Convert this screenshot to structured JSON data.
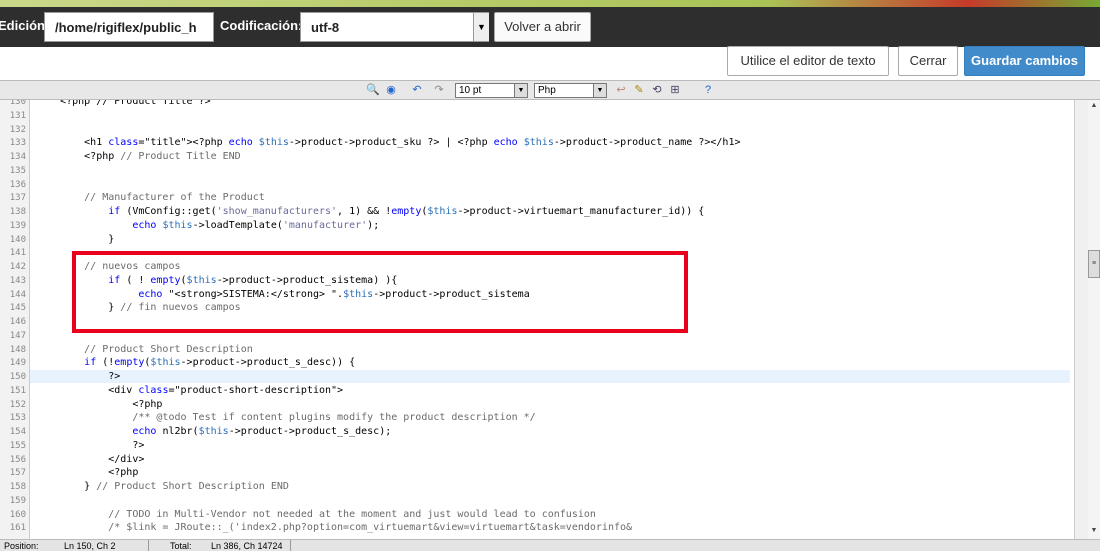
{
  "header": {
    "edit_label": "Edición:",
    "path_value": "/home/rigiflex/public_h",
    "encoding_label": "Codificación:",
    "encoding_value": "utf-8",
    "reopen_button": "Volver a abrir"
  },
  "actions": {
    "text_editor_button": "Utilice el editor de texto",
    "close_button": "Cerrar",
    "save_button": "Guardar cambios"
  },
  "toolbar": {
    "font_size": "10 pt",
    "syntax": "Php",
    "icons": [
      "find-icon",
      "replace-icon",
      "undo-icon",
      "redo-icon",
      "wrap-icon",
      "highlight-icon",
      "reset-icon",
      "fullscreen-icon",
      "help-icon"
    ]
  },
  "editor": {
    "highlighted_line": "150",
    "lines": [
      {
        "n": "130",
        "t": "    <?php // Product Title ?>"
      },
      {
        "n": "131",
        "t": ""
      },
      {
        "n": "132",
        "t": ""
      },
      {
        "n": "133",
        "t": "        <h1 class=\"title\"><?php echo $this->product->product_sku ?> | <?php echo $this->product->product_name ?></h1>"
      },
      {
        "n": "134",
        "t": "        <?php // Product Title END"
      },
      {
        "n": "135",
        "t": ""
      },
      {
        "n": "136",
        "t": ""
      },
      {
        "n": "137",
        "t": "        // Manufacturer of the Product"
      },
      {
        "n": "138",
        "t": "            if (VmConfig::get('show_manufacturers', 1) && !empty($this->product->virtuemart_manufacturer_id)) {"
      },
      {
        "n": "139",
        "t": "                echo $this->loadTemplate('manufacturer');"
      },
      {
        "n": "140",
        "t": "            }"
      },
      {
        "n": "141",
        "t": ""
      },
      {
        "n": "142",
        "t": "        // nuevos campos"
      },
      {
        "n": "143",
        "t": "            if ( ! empty($this->product->product_sistema) ){"
      },
      {
        "n": "144",
        "t": "                 echo \"<strong>SISTEMA:</strong> \".$this->product->product_sistema"
      },
      {
        "n": "145",
        "t": "            } // fin nuevos campos"
      },
      {
        "n": "146",
        "t": ""
      },
      {
        "n": "147",
        "t": ""
      },
      {
        "n": "148",
        "t": "        // Product Short Description"
      },
      {
        "n": "149",
        "t": "        if (!empty($this->product->product_s_desc)) {"
      },
      {
        "n": "150",
        "t": "            ?>"
      },
      {
        "n": "151",
        "t": "            <div class=\"product-short-description\">"
      },
      {
        "n": "152",
        "t": "                <?php"
      },
      {
        "n": "153",
        "t": "                /** @todo Test if content plugins modify the product description */"
      },
      {
        "n": "154",
        "t": "                echo nl2br($this->product->product_s_desc);"
      },
      {
        "n": "155",
        "t": "                ?>"
      },
      {
        "n": "156",
        "t": "            </div>"
      },
      {
        "n": "157",
        "t": "            <?php"
      },
      {
        "n": "158",
        "t": "        } // Product Short Description END"
      },
      {
        "n": "159",
        "t": ""
      },
      {
        "n": "160",
        "t": "            // TODO in Multi-Vendor not needed at the moment and just would lead to confusion"
      },
      {
        "n": "161",
        "t": "            /* $link = JRoute::_('index2.php?option=com_virtuemart&view=virtuemart&task=vendorinfo&"
      }
    ]
  },
  "status": {
    "position_label": "Position:",
    "position_value": "Ln 150, Ch 2",
    "total_label": "Total:",
    "total_value": "Ln 386, Ch 14724"
  },
  "colors": {
    "keyword": "#0000ff",
    "variable": "#2b6fb7",
    "string": "#6a6a9a",
    "comment": "#6b6b6b",
    "primary_button": "#428bca",
    "highlight_box": "#e8001c"
  }
}
